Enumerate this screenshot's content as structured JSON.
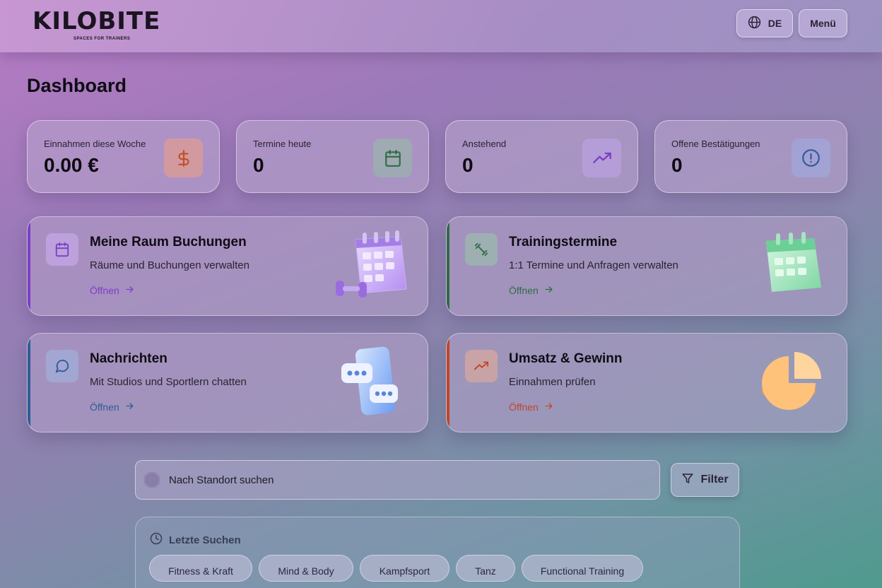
{
  "header": {
    "logo_text": "KILOBITE",
    "logo_tagline": "SPACES FOR TRAINERS",
    "language_label": "DE",
    "menu_label": "Menü"
  },
  "page_title": "Dashboard",
  "stats": [
    {
      "label": "Einnahmen diese Woche",
      "value": "0.00 €",
      "icon": "dollar-icon",
      "color": "#c0502a"
    },
    {
      "label": "Termine heute",
      "value": "0",
      "icon": "calendar-icon",
      "color": "#2f6b45"
    },
    {
      "label": "Anstehend",
      "value": "0",
      "icon": "trending-up-icon",
      "color": "#7b3fc4"
    },
    {
      "label": "Offene Bestätigungen",
      "value": "0",
      "icon": "alert-circle-icon",
      "color": "#3a5a9a"
    }
  ],
  "cards": [
    {
      "title": "Meine Raum Buchungen",
      "subtitle": "Räume und Buchungen verwalten",
      "open_label": "Öffnen",
      "icon": "calendar-icon",
      "accent": "#7b3fc4"
    },
    {
      "title": "Trainingstermine",
      "subtitle": "1:1 Termine und Anfragen verwalten",
      "open_label": "Öffnen",
      "icon": "dumbbell-icon",
      "accent": "#2f6b45"
    },
    {
      "title": "Nachrichten",
      "subtitle": "Mit Studios und Sportlern chatten",
      "open_label": "Öffnen",
      "icon": "chat-icon",
      "accent": "#2f5c96"
    },
    {
      "title": "Umsatz & Gewinn",
      "subtitle": "Einnahmen prüfen",
      "open_label": "Öffnen",
      "icon": "trending-up-icon",
      "accent": "#c0452a"
    }
  ],
  "search": {
    "placeholder": "Nach Standort suchen",
    "filter_label": "Filter"
  },
  "recent": {
    "title": "Letzte Suchen",
    "chips": [
      "Fitness & Kraft",
      "Mind & Body",
      "Kampfsport",
      "Tanz",
      "Functional Training"
    ]
  }
}
